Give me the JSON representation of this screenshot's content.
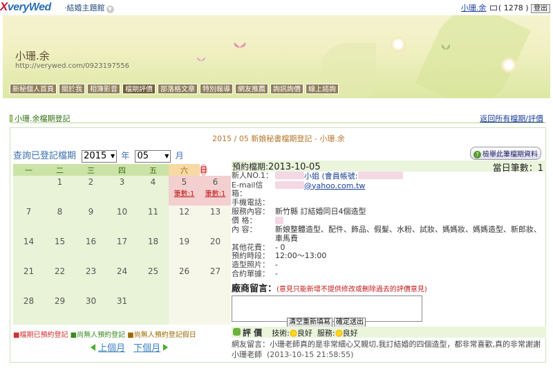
{
  "topbar": {
    "logo_mark": "X",
    "logo_text": "veryWed",
    "theme_label": "‧結婚主題館",
    "user_name": "小珊.余",
    "message_count": "( 1278 )",
    "logout": "登出"
  },
  "banner": {
    "title": "小珊.余",
    "url": "http://verywed.com/0923197556"
  },
  "nav": [
    {
      "label": "新秘個人首頁"
    },
    {
      "label": "關於我"
    },
    {
      "label": "相簿影音"
    },
    {
      "label": "檔期評價"
    },
    {
      "label": "部落格文章"
    },
    {
      "label": "特別報導"
    },
    {
      "label": "網友推薦"
    },
    {
      "label": "詢訊詢價"
    },
    {
      "label": "線上諮詢"
    }
  ],
  "section": {
    "name": "小珊.余檔期登記",
    "back_link": "返回所有檔期/評價"
  },
  "heading": "2015 / 05 新娘秘書檔期登記 - 小珊.余",
  "query": {
    "label": "查詢已登記檔期",
    "year": "2015",
    "year_unit": "年",
    "month": "05",
    "month_unit": "月"
  },
  "detail_button": "檢舉此筆檔期資料",
  "calendar": {
    "weekdays": [
      "一",
      "二",
      "三",
      "四",
      "五",
      "六",
      "日"
    ],
    "weeks": [
      [
        "",
        "1",
        "2",
        "3",
        "4",
        "5",
        "6"
      ],
      [
        "7",
        "8",
        "9",
        "10",
        "11",
        "12",
        "13"
      ],
      [
        "14",
        "15",
        "16",
        "17",
        "18",
        "19",
        "20"
      ],
      [
        "21",
        "22",
        "23",
        "24",
        "25",
        "26",
        "27"
      ],
      [
        "28",
        "29",
        "30",
        "31",
        "",
        "",
        ""
      ]
    ],
    "booked_days": [
      "5",
      "6"
    ],
    "booked_label": "筆數:1"
  },
  "legend": {
    "booked": "■檔期已預約登記",
    "free": "■尚無人預約登記",
    "free_holiday": "■尚無人預約登記假日"
  },
  "month_nav": {
    "prev": "上個月",
    "next": "下個月"
  },
  "detail": {
    "booking_label": "預約檔期:",
    "booking_date": "2013-10-05",
    "day_count": "當日筆數：1",
    "rows": [
      {
        "key": "新人NO.1：",
        "value": "小姐  (會員帳號:"
      },
      {
        "key": "E-mail信箱：",
        "value": "@yahoo.com.tw"
      },
      {
        "key": "手機電話：",
        "value": ""
      },
      {
        "key": "服務內容：",
        "value": "新竹縣 訂結婚同日4個造型"
      },
      {
        "key": "價    格：",
        "value": ""
      },
      {
        "key": "內    容：",
        "value": "新娘整體造型、配件、飾品、假髮、水粉、試妝、媽媽妝、媽媽造型、新郎妝、車馬費"
      },
      {
        "key": "其他花費：",
        "value": "- 0"
      },
      {
        "key": "預約時段：",
        "value": "12:00～13:00"
      },
      {
        "key": "造型照片：",
        "value": "-"
      },
      {
        "key": "合約單據：",
        "value": "-"
      }
    ],
    "message_label": "廠商留言：",
    "message_note": "(意見只能新增不提供修改或刪除過去的評價意見)",
    "btn_reset": "清空重新填寫",
    "btn_submit": "確定送出"
  },
  "rating": {
    "label": "評 價",
    "tech_label": "技術:",
    "tech_value": "良好",
    "service_label": "服務:",
    "service_value": "良好"
  },
  "comment": {
    "text": "網友留言：小珊老師真的是非常細心又親切,我訂結婚的四個造型，都非常喜歡,真的非常謝謝小珊老師",
    "timestamp": "(2013-10-15 21:58:55)"
  }
}
